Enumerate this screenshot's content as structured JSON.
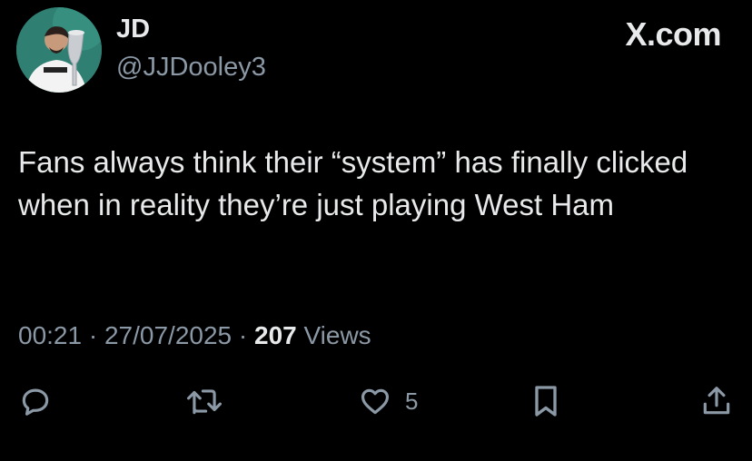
{
  "author": {
    "display_name": "JD",
    "handle": "@JJDooley3"
  },
  "brand": "X.com",
  "tweet": {
    "text": "Fans always think their “system” has finally clicked when in reality they’re just playing West Ham"
  },
  "meta": {
    "time": "00:21",
    "separator": "·",
    "date": "27/07/2025",
    "views_count": "207",
    "views_label": "Views"
  },
  "actions": {
    "likes_count": "5"
  },
  "icons": {
    "reply": "reply-icon",
    "repost": "repost-icon",
    "like": "heart-icon",
    "bookmark": "bookmark-icon",
    "share": "share-icon"
  },
  "colors": {
    "background": "#000000",
    "primary_text": "#e7e9ea",
    "secondary_text": "#8b98a5"
  }
}
